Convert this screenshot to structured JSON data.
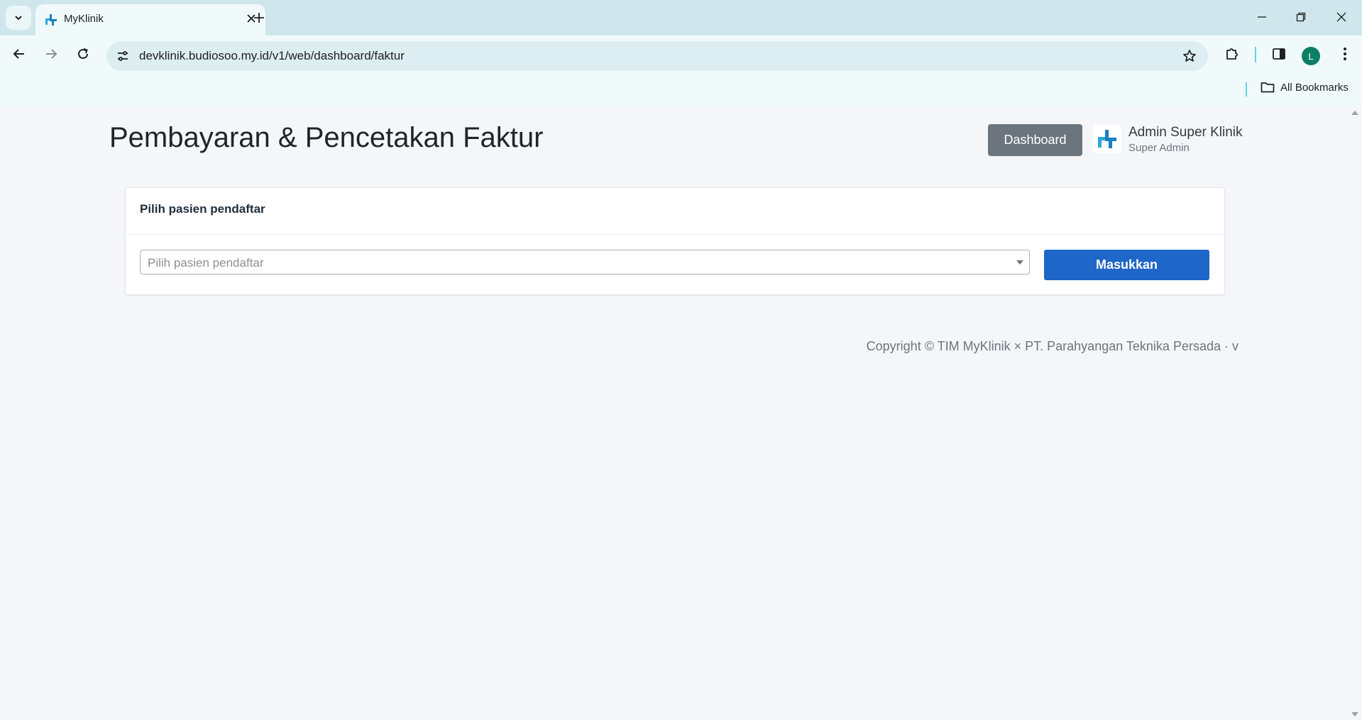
{
  "browser": {
    "tab_title": "MyKlinik",
    "url": "devklinik.budiosoo.my.id/v1/web/dashboard/faktur",
    "bookmarks_label": "All Bookmarks",
    "profile_initial": "L"
  },
  "header": {
    "title": "Pembayaran & Pencetakan Faktur",
    "dashboard_label": "Dashboard",
    "user_name": "Admin Super Klinik",
    "user_role": "Super Admin"
  },
  "card": {
    "title": "Pilih pasien pendaftar",
    "select_placeholder": "Pilih pasien pendaftar",
    "submit_label": "Masukkan"
  },
  "footer": {
    "text": "Copyright © TIM MyKlinik × PT. Parahyangan Teknika Persada  ·  v"
  },
  "colors": {
    "primary": "#1e66c7",
    "secondary": "#6c757d",
    "brand": "#1a7fc1",
    "page_bg": "#f4f6f9"
  }
}
